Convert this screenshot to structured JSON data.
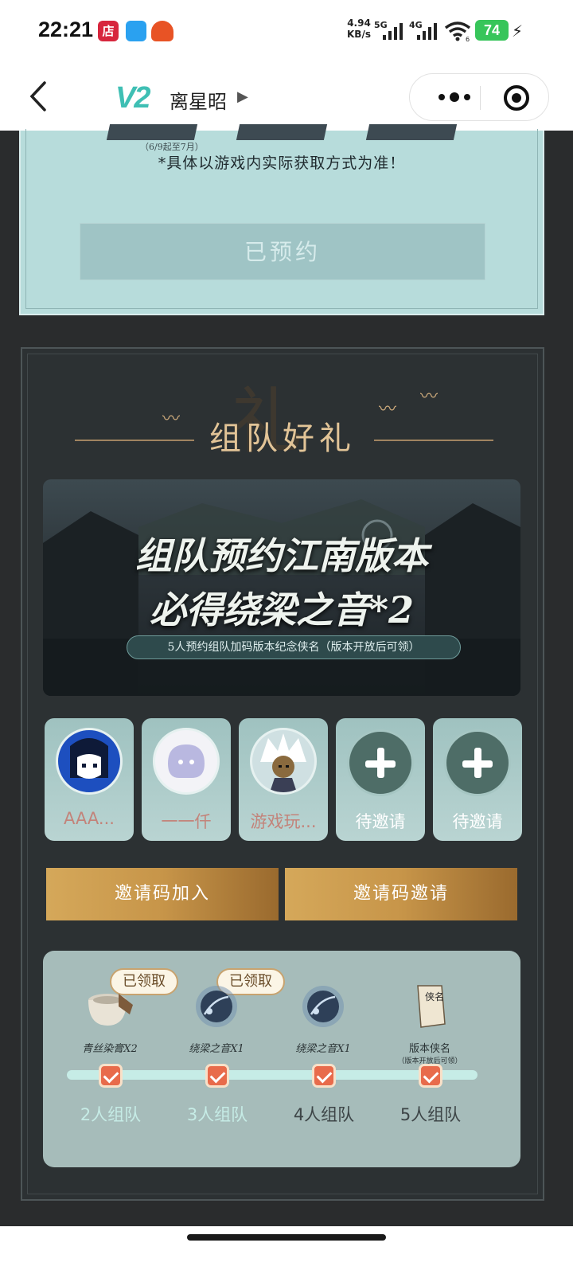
{
  "status_bar": {
    "time": "22:21",
    "shop_icon_text": "店",
    "net_speed_value": "4.94",
    "net_speed_unit": "KB/s",
    "sim1_label": "5G",
    "sim2_label": "4G",
    "wifi_badge": "6",
    "battery": "74"
  },
  "nav": {
    "logo": "V2",
    "title": "离星昭",
    "title_arrow": "▶"
  },
  "reserve": {
    "date_note": "（6/9起至7月）",
    "disclaimer": "*具体以游戏内实际获取方式为准！",
    "reserved_label": "已预约"
  },
  "team": {
    "title": "组队好礼",
    "banner": {
      "line1": "组队预约江南版本",
      "line2": "必得绕梁之音*2",
      "subtitle": "5人预约组队加码版本纪念侠名（版本开放后可领）"
    },
    "members": [
      {
        "name": "AAA...",
        "avatar": "blue-anime-avatar"
      },
      {
        "name": "一一仟",
        "avatar": "ghost-placeholder-avatar"
      },
      {
        "name": "游戏玩...",
        "avatar": "white-hair-character-avatar"
      },
      {
        "name": "待邀请",
        "avatar": "plus-icon"
      },
      {
        "name": "待邀请",
        "avatar": "plus-icon"
      }
    ],
    "join_by_code": "邀请码加入",
    "invite_by_code": "邀请码邀请",
    "rewards": [
      {
        "label": "青丝染膏X2",
        "sub": "",
        "claimed": "已领取",
        "tier": "2人组队",
        "icon": "dye-jar-icon"
      },
      {
        "label": "绕梁之音X1",
        "sub": "",
        "claimed": "已领取",
        "tier": "3人组队",
        "icon": "music-charm-icon"
      },
      {
        "label": "绕梁之音X1",
        "sub": "",
        "claimed": "",
        "tier": "4人组队",
        "icon": "music-charm-icon"
      },
      {
        "label": "版本侠名",
        "sub": "（版本开放后可领）",
        "claimed": "",
        "tier": "5人组队",
        "icon": "name-scroll-icon"
      }
    ],
    "scroll_text": "侠名"
  },
  "colors": {
    "accent_gold": "#c79549",
    "panel_teal": "#b7dcdb",
    "team_bg": "#2c3133",
    "progress_track": "#c6ece6",
    "check_orange": "#e86b4b"
  }
}
